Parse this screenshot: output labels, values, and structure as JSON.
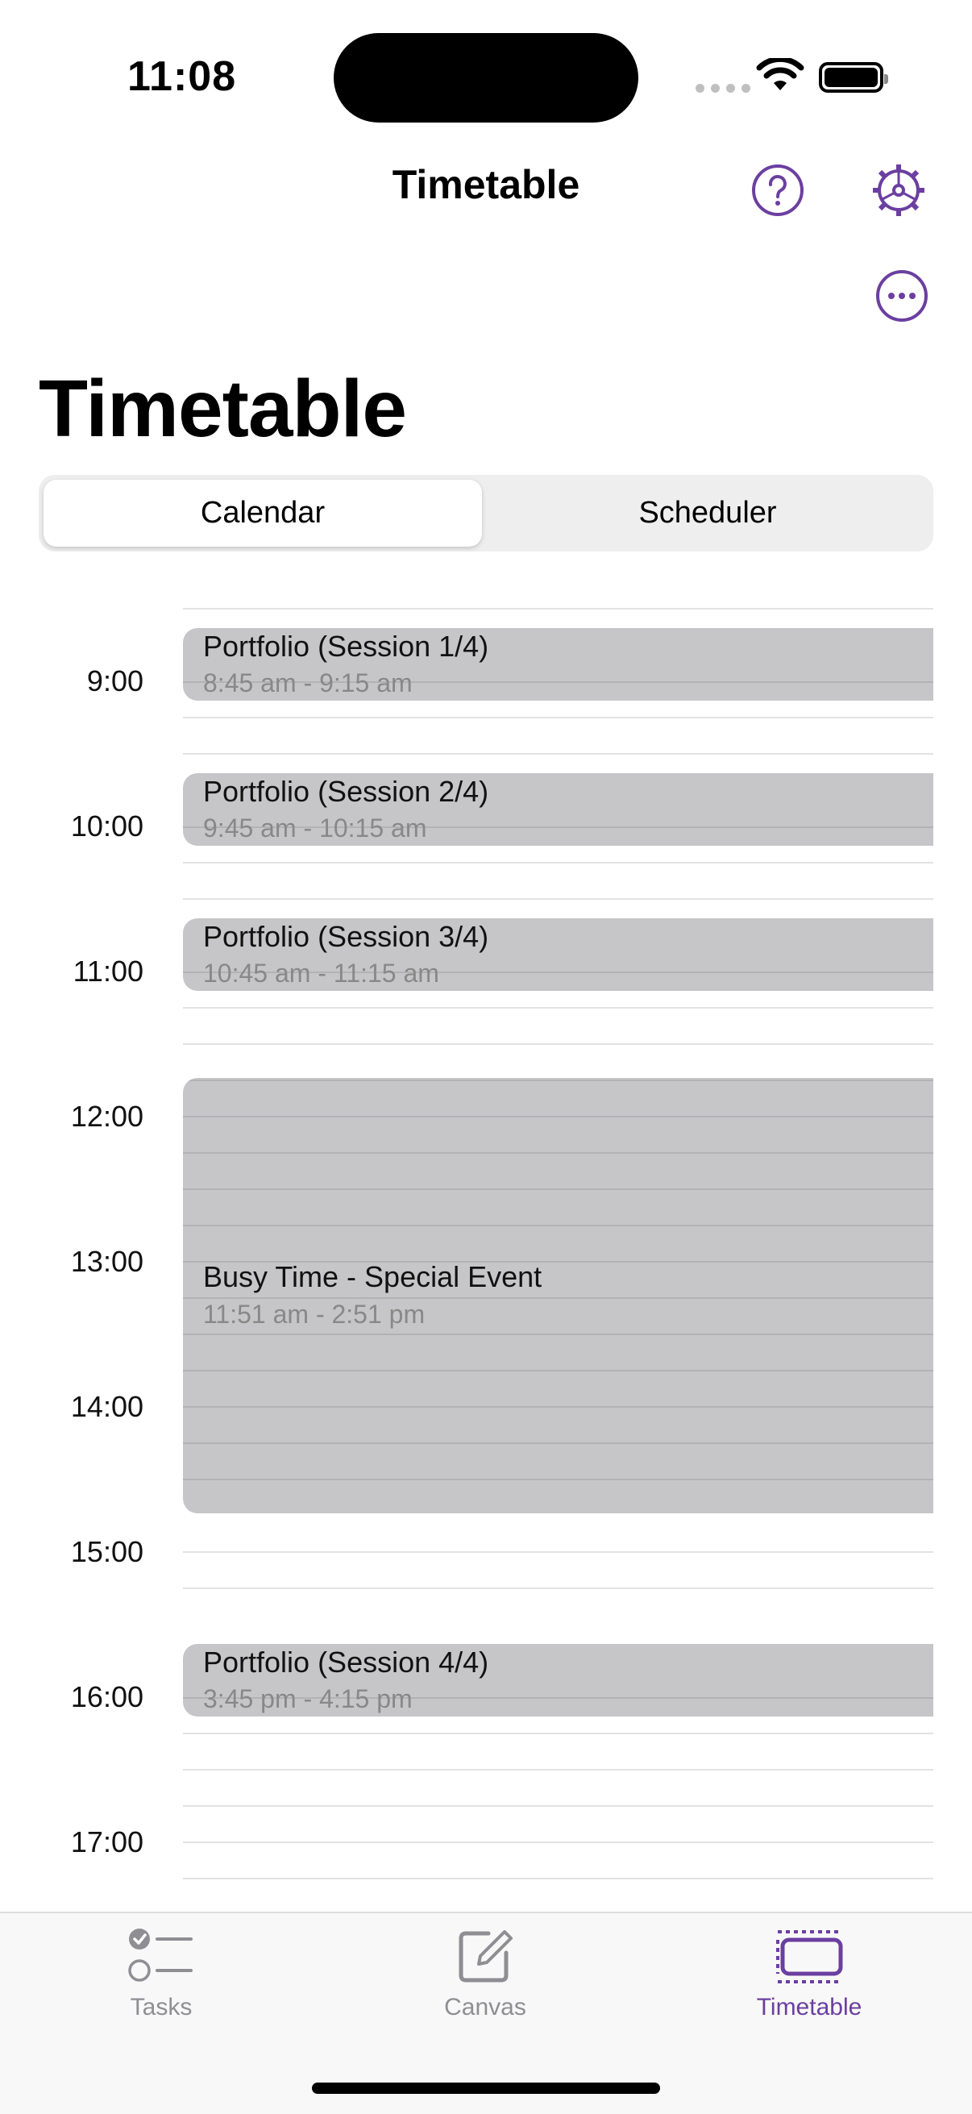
{
  "colors": {
    "accent": "#6b3fa0",
    "event_fill": "#c6c6c8",
    "inactive_tab": "#8e8e93"
  },
  "status_bar": {
    "time": "11:08"
  },
  "nav": {
    "title": "Timetable",
    "help_icon": "question-circle-icon",
    "settings_icon": "gear-icon",
    "more_icon": "ellipsis-circle-icon"
  },
  "page": {
    "large_title": "Timetable"
  },
  "segmented": {
    "calendar": "Calendar",
    "scheduler": "Scheduler",
    "selected": "Calendar"
  },
  "timetable": {
    "hours": [
      "9:00",
      "10:00",
      "11:00",
      "12:00",
      "13:00",
      "14:00",
      "15:00",
      "16:00",
      "17:00"
    ],
    "events": [
      {
        "title": "Portfolio (Session 1/4)",
        "time": "8:45 am - 9:15 am"
      },
      {
        "title": "Portfolio (Session 2/4)",
        "time": "9:45 am - 10:15 am"
      },
      {
        "title": "Portfolio (Session 3/4)",
        "time": "10:45 am - 11:15 am"
      },
      {
        "title": "Busy Time - Special Event",
        "time": "11:51 am - 2:51 pm"
      },
      {
        "title": "Portfolio (Session 4/4)",
        "time": "3:45 pm - 4:15 pm"
      }
    ]
  },
  "tabbar": {
    "tasks": {
      "label": "Tasks",
      "icon": "checklist-icon"
    },
    "canvas": {
      "label": "Canvas",
      "icon": "square-pencil-icon"
    },
    "timetable": {
      "label": "Timetable",
      "icon": "timetable-icon"
    },
    "selected": "Timetable"
  }
}
